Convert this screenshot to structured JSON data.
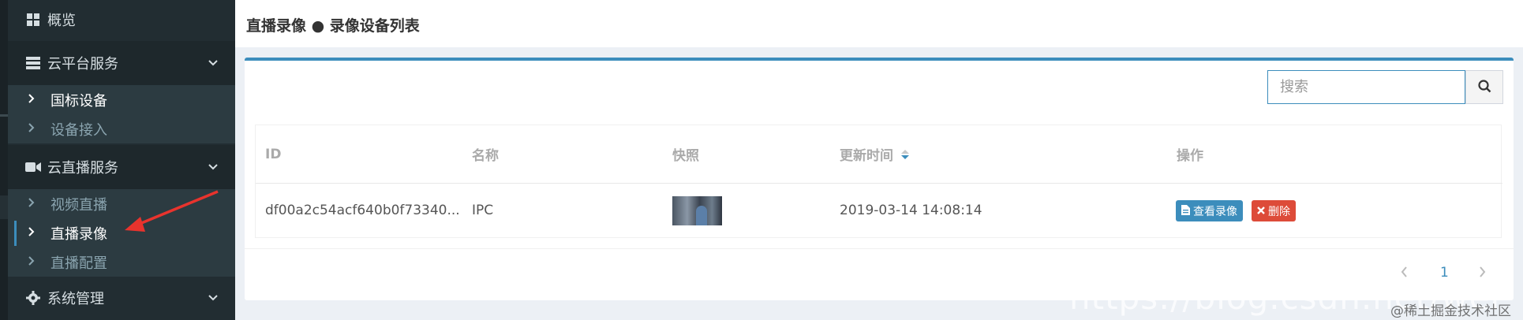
{
  "sidebar": {
    "overview": {
      "label": "概览",
      "icon": "dashboard-icon"
    },
    "cloud_platform": {
      "label": "云平台服务",
      "icon": "server-icon",
      "items": [
        {
          "label": "国标设备"
        },
        {
          "label": "设备接入"
        }
      ]
    },
    "cloud_live": {
      "label": "云直播服务",
      "icon": "video-camera-icon",
      "items": [
        {
          "label": "视频直播"
        },
        {
          "label": "直播录像"
        },
        {
          "label": "直播配置"
        }
      ]
    },
    "system": {
      "label": "系统管理",
      "icon": "gear-icon"
    }
  },
  "header": {
    "title": "直播录像 ● 录像设备列表"
  },
  "search": {
    "placeholder": "搜索"
  },
  "table": {
    "columns": [
      "ID",
      "名称",
      "快照",
      "更新时间",
      "操作"
    ],
    "rows": [
      {
        "id": "df00a2c54acf640b0f73340...",
        "name": "IPC",
        "time": "2019-03-14 14:08:14"
      }
    ],
    "actions": {
      "view": "查看录像",
      "delete": "删除"
    }
  },
  "pagination": {
    "current": "1"
  },
  "watermark": {
    "url": "https://blog.csdn.net/wei",
    "community": "@稀土掘金技术社区"
  },
  "colors": {
    "accent": "#3c8dbc",
    "danger": "#dd4b39",
    "sidebar": "#222d32",
    "annotation": "#e8332d"
  }
}
